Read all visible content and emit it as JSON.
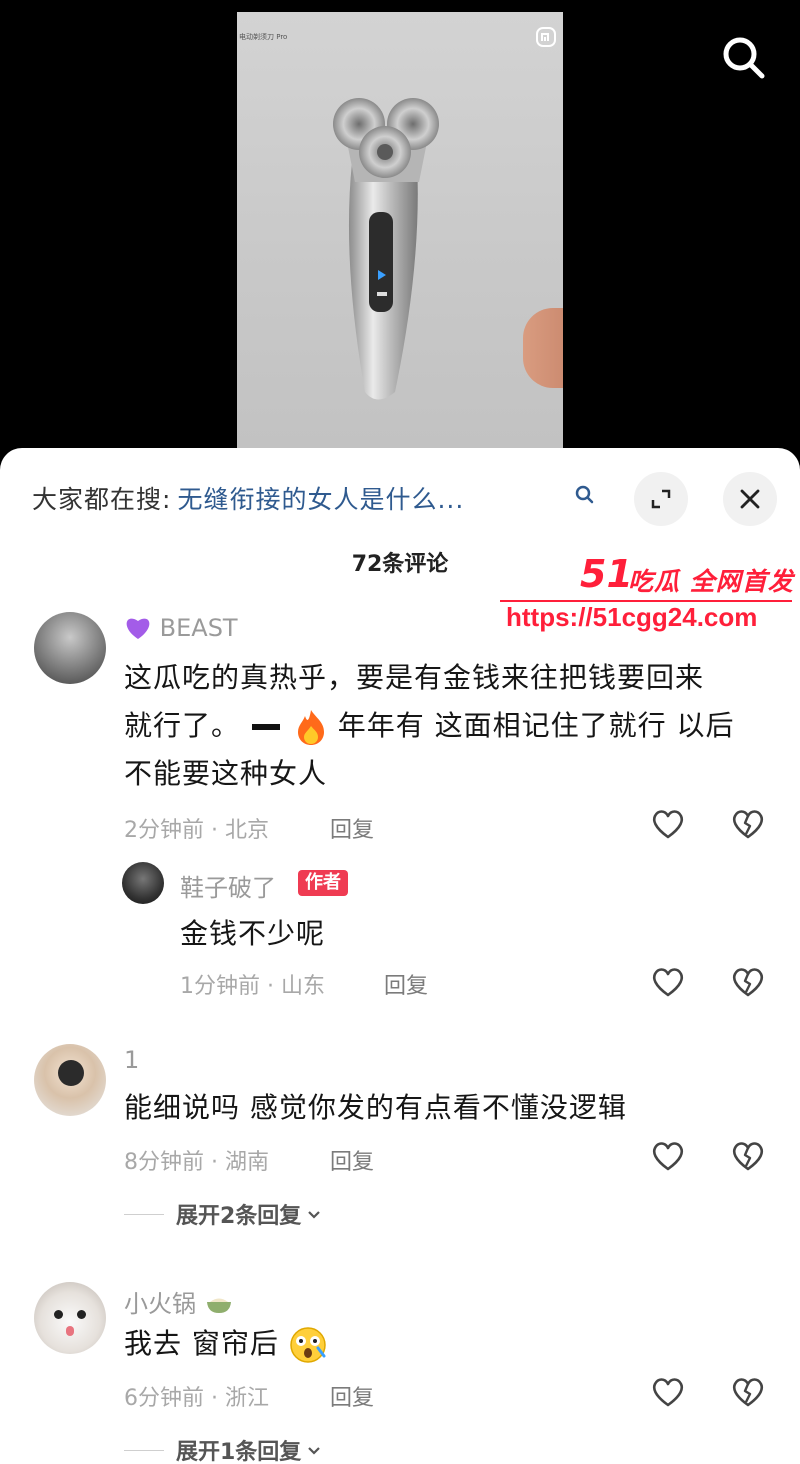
{
  "video": {
    "photo_caption": "电动剃须刀 Pro"
  },
  "search_bar": {
    "prefix": "大家都在搜:",
    "query": "无缝衔接的女人是什么..."
  },
  "comments_count": "72条评论",
  "watermark": {
    "number": "51",
    "text": "吃瓜 全网首发",
    "url": "https://51cgg24.com"
  },
  "comments": [
    {
      "username": "BEAST",
      "text_lines": [
        "这瓜吃的真热乎，要是有金钱来往把钱要回来",
        "就行了。",
        "年年有 这面相记住了就行 以后",
        "不能要这种女人"
      ],
      "meta": "2分钟前 · 北京",
      "reply_label": "回复",
      "reply": {
        "username": "鞋子破了",
        "badge": "作者",
        "text": "金钱不少呢",
        "meta": "1分钟前 · 山东",
        "reply_label": "回复"
      }
    },
    {
      "username": "1",
      "text": "能细说吗 感觉你发的有点看不懂没逻辑",
      "meta": "8分钟前 · 湖南",
      "reply_label": "回复",
      "expand_label": "展开2条回复"
    },
    {
      "username": "小火锅",
      "text": "我去 窗帘后",
      "meta": "6分钟前 · 浙江",
      "reply_label": "回复",
      "expand_label": "展开1条回复"
    }
  ],
  "colors": {
    "link": "#2f5a8f",
    "watermark": "#ff1f3a",
    "author_badge": "#ef3b52"
  }
}
